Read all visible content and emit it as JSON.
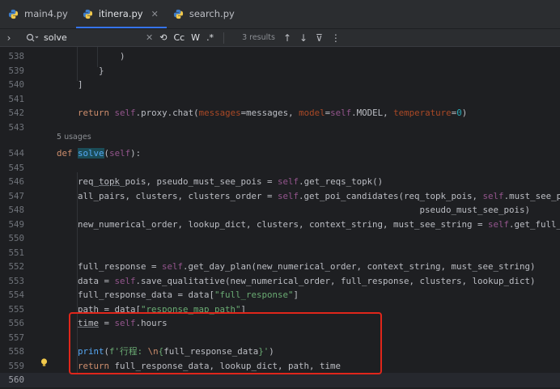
{
  "tabs": [
    {
      "label": "main4.py",
      "active": false
    },
    {
      "label": "itinera.py",
      "active": true
    },
    {
      "label": "search.py",
      "active": false
    }
  ],
  "find": {
    "query": "solve",
    "case_label": "Cc",
    "word_label": "W",
    "regex_label": ".*",
    "results": "3 results"
  },
  "editor": {
    "usages": "5 usages",
    "lines": [
      {
        "n": "538",
        "t": "            )"
      },
      {
        "n": "539",
        "t": "        }"
      },
      {
        "n": "540",
        "t": "    ]"
      },
      {
        "n": "541",
        "t": ""
      },
      {
        "n": "542",
        "t": "    return self.proxy.chat(messages=messages, model=self.MODEL, temperature=0)"
      },
      {
        "n": "543",
        "t": ""
      },
      {
        "n": "544",
        "t": "def solve(self):"
      },
      {
        "n": "545",
        "t": ""
      },
      {
        "n": "546",
        "t": "    req_topk_pois, pseudo_must_see_pois = self.get_reqs_topk()"
      },
      {
        "n": "547",
        "t": "    all_pairs, clusters, clusters_order = self.get_poi_candidates(req_topk_pois, self.must_see_pois,"
      },
      {
        "n": "548",
        "t": "                                                                     pseudo_must_see_pois)"
      },
      {
        "n": "549",
        "t": "    new_numerical_order, lookup_dict, clusters, context_string, must_see_string = self.get_full_orde"
      },
      {
        "n": "550",
        "t": ""
      },
      {
        "n": "551",
        "t": ""
      },
      {
        "n": "552",
        "t": "    full_response = self.get_day_plan(new_numerical_order, context_string, must_see_string)"
      },
      {
        "n": "553",
        "t": "    data = self.save_qualitative(new_numerical_order, full_response, clusters, lookup_dict)"
      },
      {
        "n": "554",
        "t": "    full_response_data = data[\"full_response\"]"
      },
      {
        "n": "555",
        "t": "    path = data[\"response_map_path\"]"
      },
      {
        "n": "556",
        "t": "    time = self.hours"
      },
      {
        "n": "557",
        "t": ""
      },
      {
        "n": "558",
        "t": "    print(f'行程: \\n{full_response_data}')"
      },
      {
        "n": "559",
        "t": "    return full_response_data, lookup_dict, path, time"
      },
      {
        "n": "560",
        "t": ""
      }
    ]
  },
  "colors": {
    "background": "#1e1f22",
    "keyword": "#cf8e6d",
    "self": "#94558d",
    "function": "#56a8f5",
    "param": "#aa4926",
    "number": "#2aacb8",
    "string": "#6aab73",
    "annotation_box": "#e0261b"
  },
  "icons": [
    "python-file-icon",
    "close-icon",
    "chevron-right-icon",
    "search-icon",
    "replace-icon",
    "arrow-up-icon",
    "arrow-down-icon",
    "filter-icon",
    "more-icon",
    "lightbulb-icon"
  ]
}
